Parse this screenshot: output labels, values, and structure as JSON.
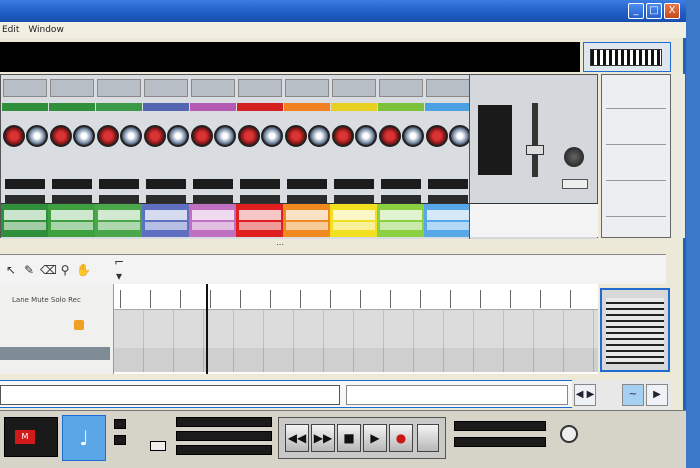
{
  "window": {
    "minimize_label": "_",
    "maximize_label": "□",
    "close_label": "X"
  },
  "menubar": {
    "items": [
      "Edit",
      "Window",
      ""
    ]
  },
  "rack": {
    "strip_colors": [
      "#2f8f3a",
      "#2f8f3a",
      "#3a9a4a",
      "#5566b0",
      "#b55ab2",
      "#d42020",
      "#f08020",
      "#e8d020",
      "#7cc23a",
      "#4aa0e0"
    ],
    "pad_colors": [
      "#2f8f3a",
      "#3fa040",
      "#4aa84a",
      "#6070c0",
      "#c070c0",
      "#e02020",
      "#f08a20",
      "#f0e020",
      "#8ad040",
      "#58a8e8"
    ]
  },
  "sequencer": {
    "column_headers": "Lane  Mute  Solo  Rec",
    "track_label": ""
  },
  "songbar": {
    "position_text": ""
  },
  "transport": {
    "cpu_label": "M",
    "rewind": "◀◀",
    "forward": "▶▶",
    "stop": "■",
    "play": "▶",
    "record": "●",
    "click_icon_glyph": "♩"
  },
  "zoom": {
    "left": "◀ ▶",
    "mid": "~",
    "right": "▶"
  }
}
